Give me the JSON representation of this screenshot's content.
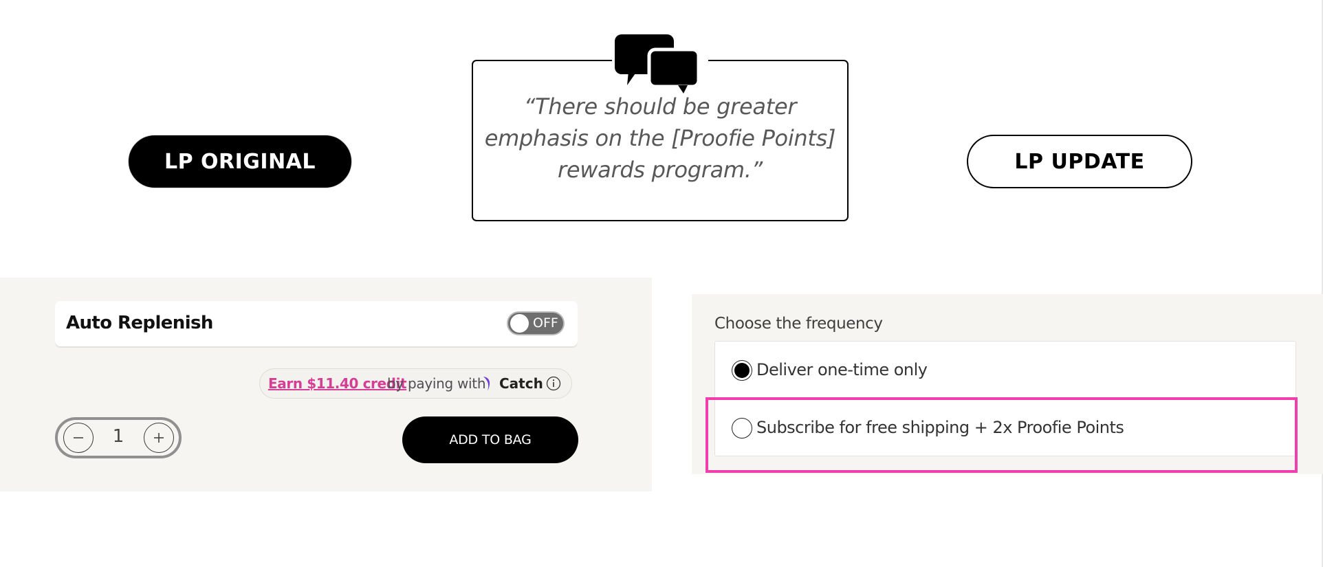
{
  "header": {
    "original_label": "LP ORIGINAL",
    "update_label": "LP UPDATE",
    "quote": "“There should be greater emphasis on the [Proofie Points] rewards program.”",
    "quote_icon": "speech-bubbles-icon"
  },
  "original": {
    "auto_replenish": {
      "label": "Auto Replenish",
      "toggle_state": "OFF"
    },
    "catch": {
      "earn_text": "Earn $11.40 credit",
      "by_text": "by paying with",
      "brand": "Catch",
      "accent_color": "#d43f95"
    },
    "quantity": "1",
    "add_to_bag": "ADD TO BAG"
  },
  "update": {
    "frequency_title": "Choose the frequency",
    "options": [
      {
        "label": "Deliver one-time only",
        "selected": true
      },
      {
        "label": "Subscribe for free shipping + 2x Proofie Points",
        "selected": false
      }
    ],
    "highlight_color": "#f03fac"
  }
}
